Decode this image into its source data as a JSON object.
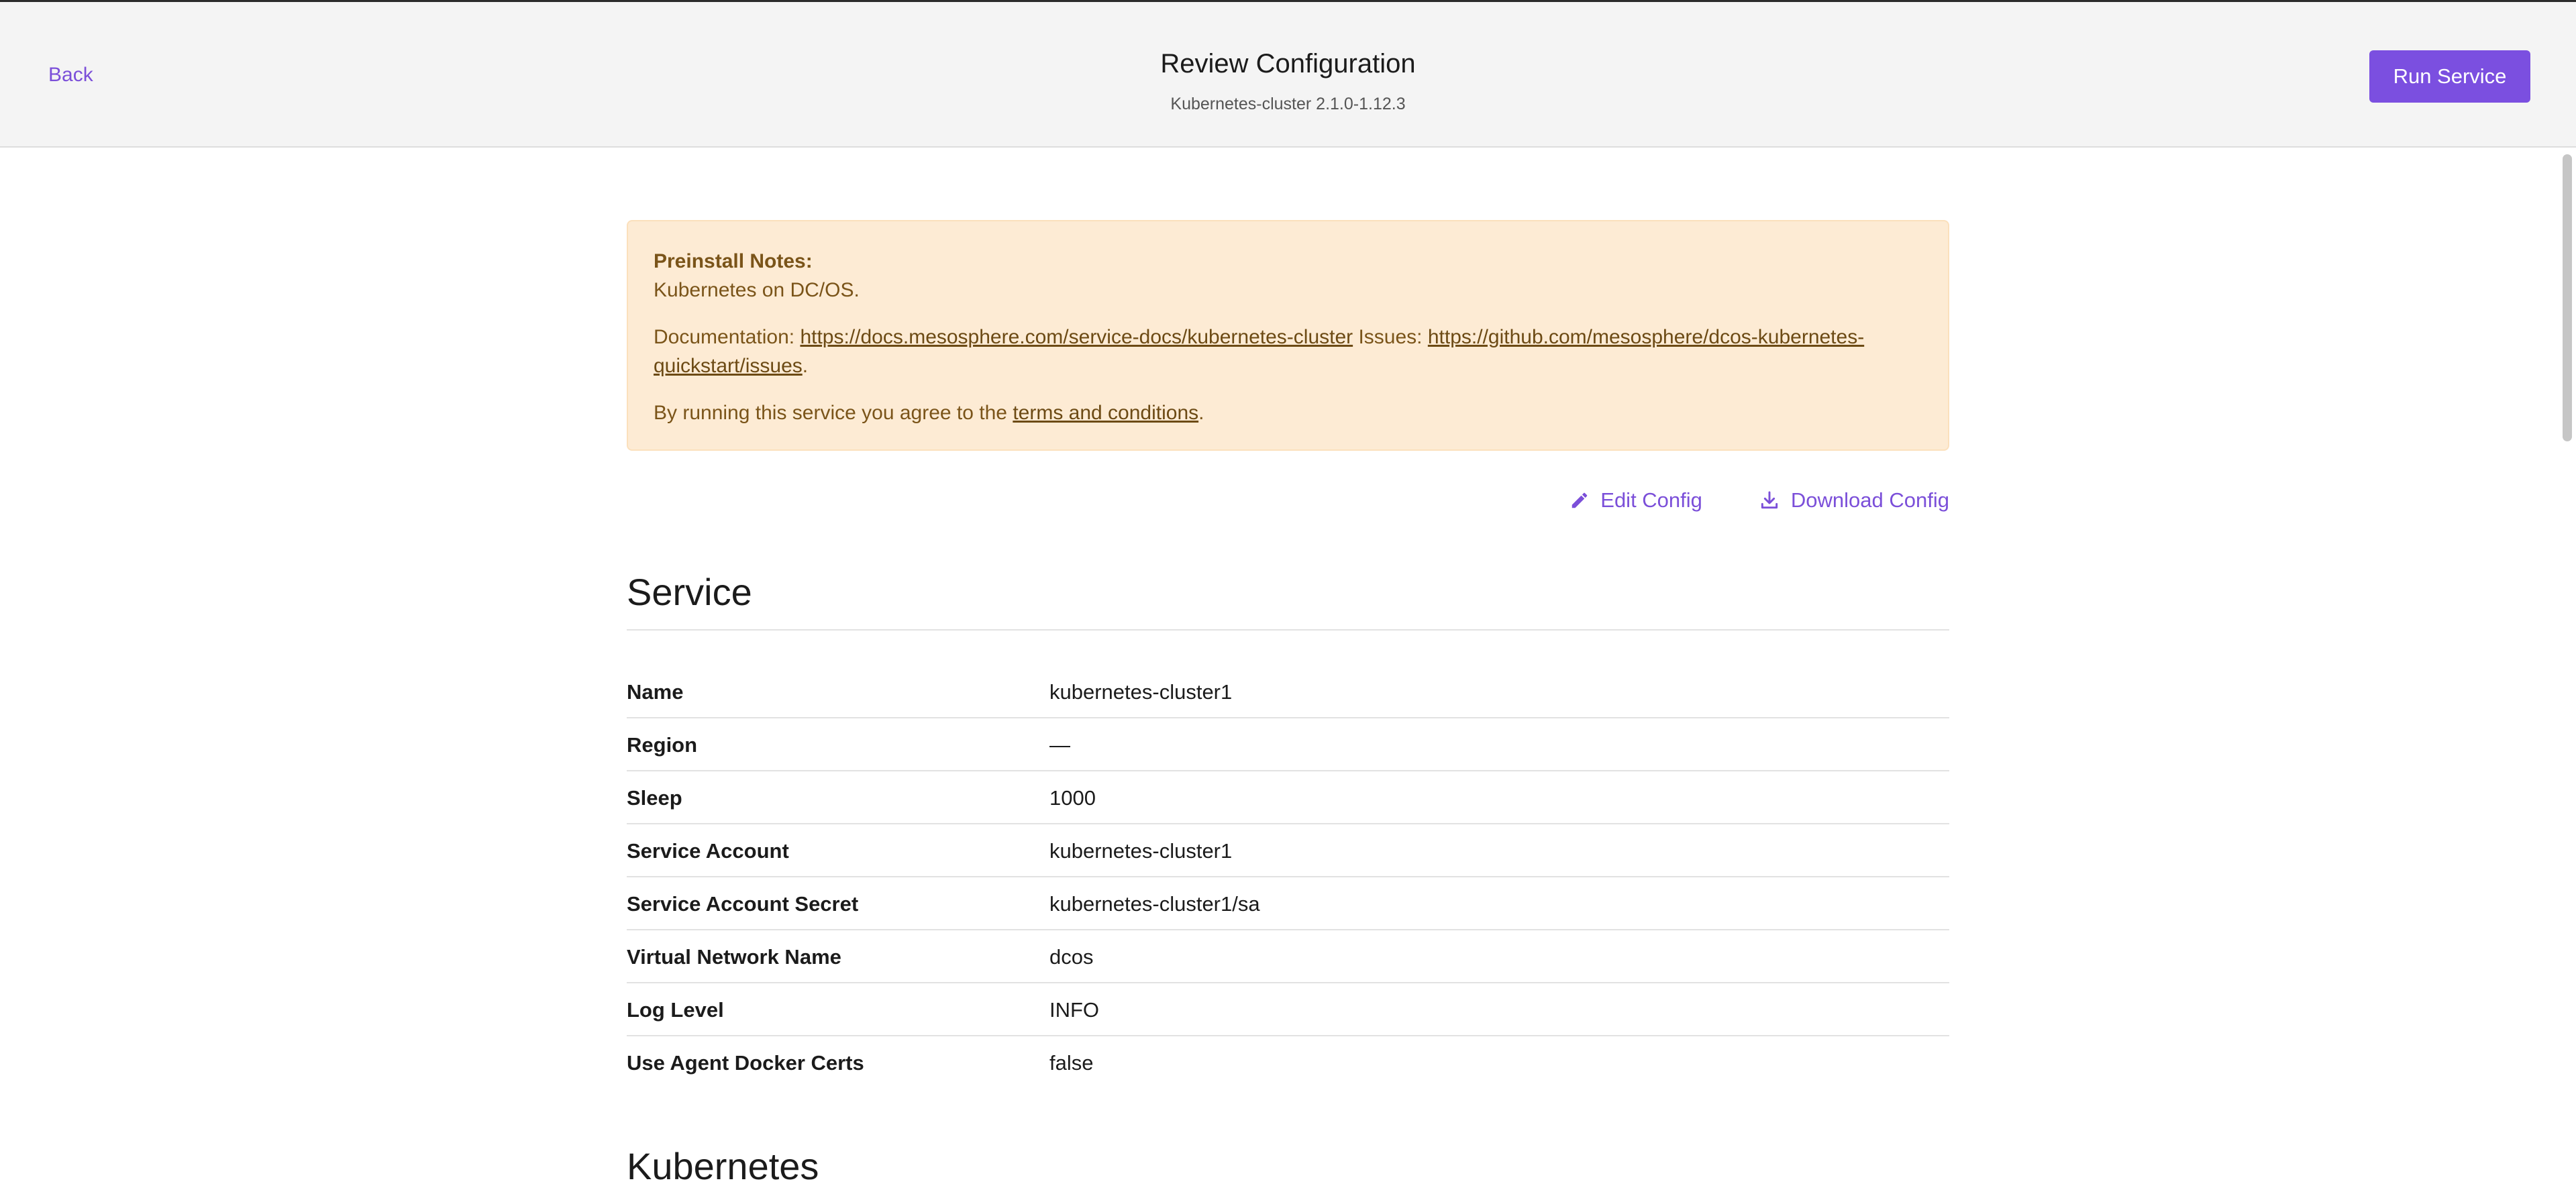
{
  "header": {
    "back_label": "Back",
    "title": "Review Configuration",
    "subtitle": "Kubernetes-cluster 2.1.0-1.12.3",
    "run_button_label": "Run Service"
  },
  "notes": {
    "heading": "Preinstall Notes:",
    "line1": "Kubernetes on DC/OS.",
    "documentation_prefix": "Documentation: ",
    "documentation_link": "https://docs.mesosphere.com/service-docs/kubernetes-cluster",
    "issues_prefix": " Issues: ",
    "issues_link_part1": "https://github.com/mesosphere/dcos-kubernetes-",
    "issues_link_part2": "quickstart/issues",
    "period": ".",
    "terms_prefix": "By running this service you agree to the ",
    "terms_link": "terms and conditions",
    "terms_suffix": "."
  },
  "actions": {
    "edit_label": "Edit Config",
    "download_label": "Download Config"
  },
  "sections": {
    "service_title": "Service",
    "kubernetes_title": "Kubernetes"
  },
  "service_rows": [
    {
      "label": "Name",
      "value": "kubernetes-cluster1"
    },
    {
      "label": "Region",
      "value": "—"
    },
    {
      "label": "Sleep",
      "value": "1000"
    },
    {
      "label": "Service Account",
      "value": "kubernetes-cluster1"
    },
    {
      "label": "Service Account Secret",
      "value": "kubernetes-cluster1/sa"
    },
    {
      "label": "Virtual Network Name",
      "value": "dcos"
    },
    {
      "label": "Log Level",
      "value": "INFO"
    },
    {
      "label": "Use Agent Docker Certs",
      "value": "false"
    }
  ],
  "colors": {
    "accent": "#7b4fe0",
    "notes_background": "#fdebd4",
    "notes_text": "#7a5419"
  },
  "icons": {
    "edit": "pencil-icon",
    "download": "download-icon"
  }
}
